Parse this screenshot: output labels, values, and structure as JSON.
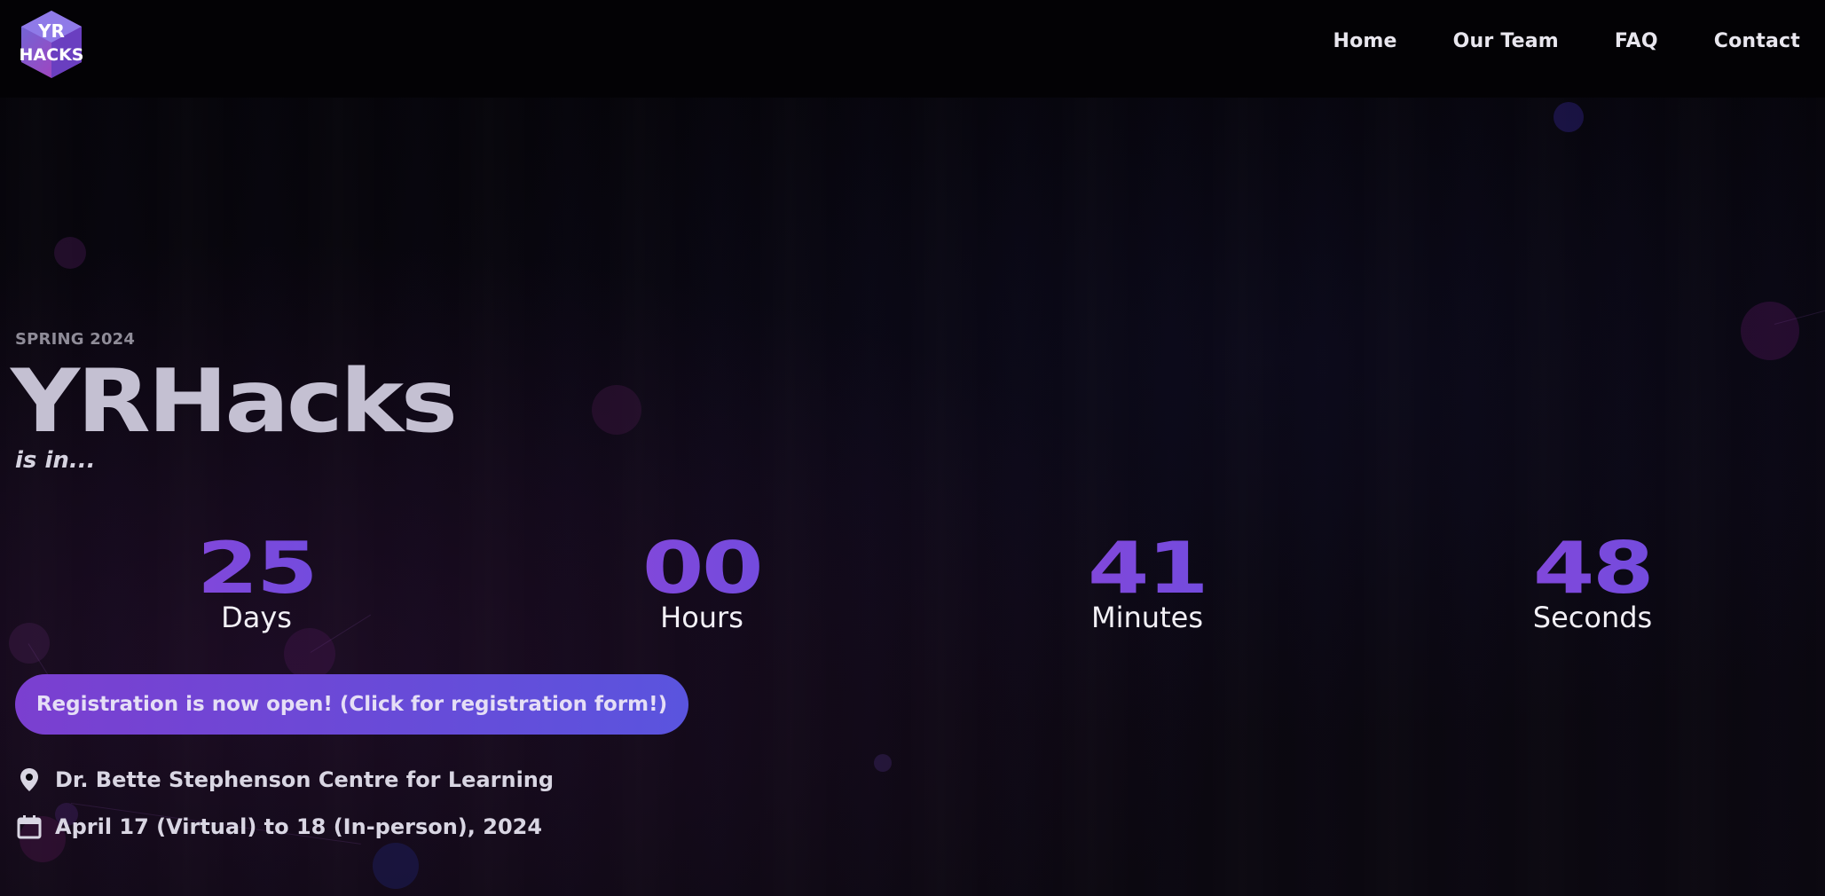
{
  "colors": {
    "accent_purple": "#7b3fd0",
    "accent_blue": "#5a54de",
    "title": "#c4c0d2",
    "background": "#07050b"
  },
  "logo": {
    "text": "YRHACKS",
    "icon": "yrhacks-cube-logo"
  },
  "nav": {
    "items": [
      {
        "label": "Home"
      },
      {
        "label": "Our Team"
      },
      {
        "label": "FAQ"
      },
      {
        "label": "Contact"
      }
    ]
  },
  "hero": {
    "eyebrow": "SPRING 2024",
    "title": "YRHacks",
    "subtitle": "is in...",
    "countdown": [
      {
        "value": "25",
        "label": "Days"
      },
      {
        "value": "00",
        "label": "Hours"
      },
      {
        "value": "41",
        "label": "Minutes"
      },
      {
        "value": "48",
        "label": "Seconds"
      }
    ],
    "register_label": "Registration is now open! (Click for registration form!)",
    "location": {
      "icon": "location-pin-icon",
      "text": "Dr. Bette Stephenson Centre for Learning"
    },
    "date": {
      "icon": "calendar-icon",
      "text": "April 17 (Virtual) to 18 (In-person), 2024"
    }
  }
}
